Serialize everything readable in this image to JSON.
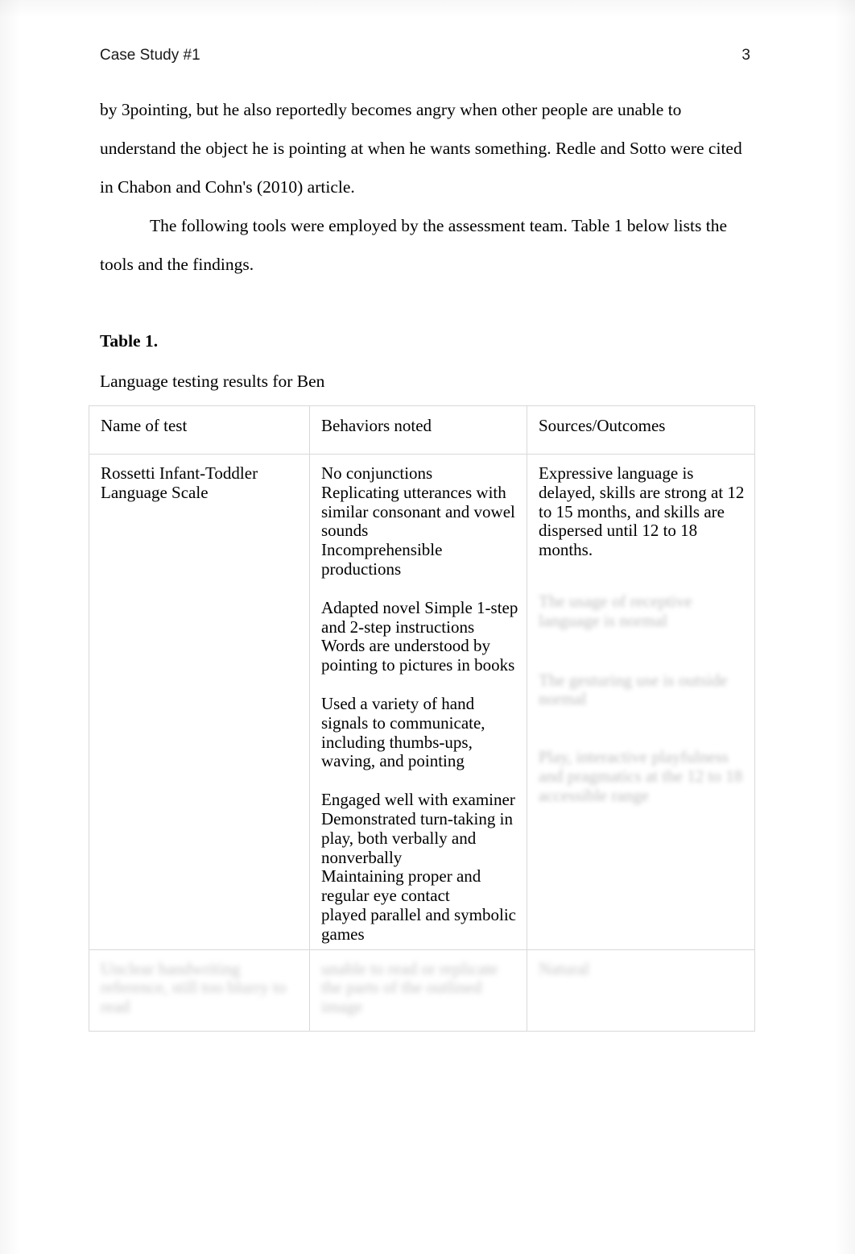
{
  "header": {
    "running_head": "Case Study #1",
    "page_number": "3"
  },
  "body": {
    "paragraph_1": "by 3pointing, but he also reportedly becomes angry when other people are unable to understand the object he is pointing at when he wants something. Redle and Sotto were cited in Chabon and Cohn's (2010) article.",
    "paragraph_2": "The following tools were employed by the assessment team. Table 1 below lists the tools and the findings."
  },
  "table": {
    "label": "Table 1.",
    "caption": "Language testing results for Ben",
    "columns": [
      "Name of test",
      "Behaviors noted",
      "Sources/Outcomes"
    ],
    "rows": [
      {
        "name_of_test": "Rossetti Infant-Toddler Language Scale",
        "behaviors_noted": [
          "No conjunctions\nReplicating utterances with similar consonant and vowel sounds\nIncomprehensible productions",
          "Adapted novel Simple 1-step and 2-step instructions\nWords are understood by pointing to pictures in books",
          "Used a variety of hand signals to communicate, including thumbs-ups, waving, and pointing",
          "Engaged well with examiner\nDemonstrated turn-taking in play, both verbally and nonverbally\nMaintaining proper and regular eye contact\nplayed parallel and symbolic games"
        ],
        "sources_outcomes": [
          "Expressive language is delayed, skills are strong at 12 to 15 months, and skills are dispersed until 12 to 18 months.",
          "The usage of receptive language is normal",
          "The gesturing use is outside normal",
          "Play, interactive playfulness and pragmatics at the 12 to 18 accessible range"
        ]
      },
      {
        "name_of_test": "Unclear handwriting reference, still too blurry to read",
        "behaviors_noted": "unable to read or replicate the parts of the outlined image",
        "sources_outcomes": "Natural"
      }
    ]
  }
}
